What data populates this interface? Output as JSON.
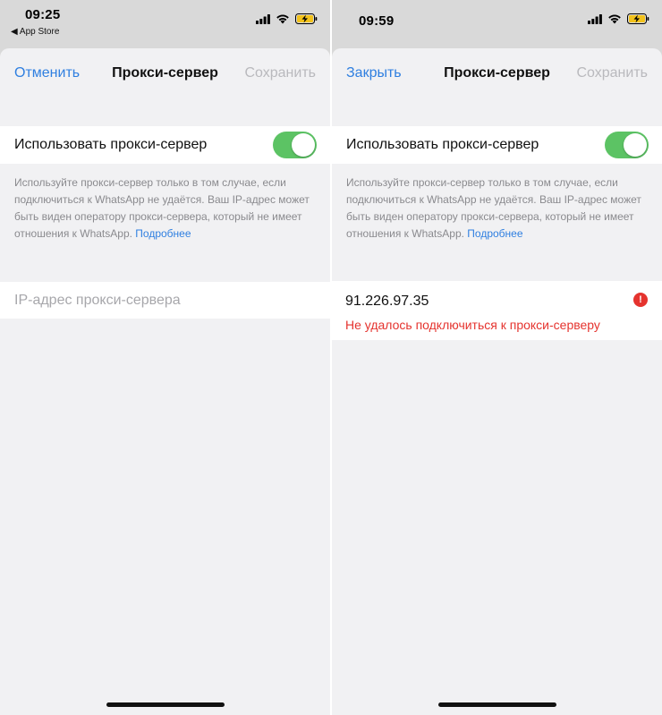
{
  "left": {
    "status": {
      "time": "09:25",
      "back_app": "◀ App Store"
    },
    "nav": {
      "left": "Отменить",
      "title": "Прокси-сервер",
      "right": "Сохранить"
    },
    "toggle": {
      "label": "Использовать прокси-сервер",
      "on": true
    },
    "note": {
      "text": "Используйте прокси-сервер только в том случае, если подключиться к WhatsApp не удаётся. Ваш IP-адрес может быть виден оператору прокси-сервера, который не имеет отношения к WhatsApp.",
      "link": "Подробнее"
    },
    "ip_input": {
      "placeholder": "IP-адрес прокси-сервера",
      "value": ""
    }
  },
  "right": {
    "status": {
      "time": "09:59"
    },
    "nav": {
      "left": "Закрыть",
      "title": "Прокси-сервер",
      "right": "Сохранить"
    },
    "toggle": {
      "label": "Использовать прокси-сервер",
      "on": true
    },
    "note": {
      "text": "Используйте прокси-сервер только в том случае, если подключиться к WhatsApp не удаётся. Ваш IP-адрес может быть виден оператору прокси-сервера, который не имеет отношения к WhatsApp.",
      "link": "Подробнее"
    },
    "ip_input": {
      "value": "91.226.97.35",
      "error": "Не удалось подключиться к прокси-серверу",
      "error_icon": "!"
    }
  },
  "colors": {
    "accent": "#2f7fe0",
    "switch_on": "#5cc364",
    "error": "#e5332e",
    "disabled": "#b9b9bd"
  },
  "icons": [
    "cellular-signal-icon",
    "wifi-icon",
    "battery-charging-icon",
    "error-icon"
  ]
}
